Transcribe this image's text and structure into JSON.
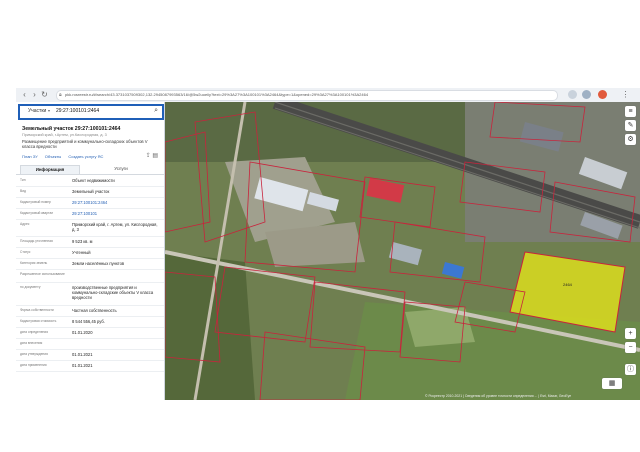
{
  "browser": {
    "url": "pkk.rosreestr.ru/#/search/43.3731037509302,132.2945087993563/16/@5w2uoeiiy?text=29%3A27%3A100101%3A2464&type=1&opened=29%3A27%3A100101%3A2464"
  },
  "search": {
    "type_label": "Участки",
    "query": "29:27:100101:2464"
  },
  "parcel": {
    "title": "Земельный участок 29:27:100101:2464",
    "address_line": "Приморский край, г.Артем, ул.Кислородная, д. 3",
    "description": "Размещение предприятий и коммунально-складских объектов V класса вредности",
    "links": [
      "План ЗУ",
      "Объекты",
      "Создать услугу ЯС"
    ]
  },
  "tabs": {
    "info": "Информация",
    "services": "Услуги"
  },
  "rows": [
    {
      "k": "Тип",
      "v": "Объект недвижимости",
      "link": false
    },
    {
      "k": "Вид",
      "v": "Земельный участок",
      "link": false
    },
    {
      "k": "Кадастровый номер",
      "v": "29:27:100101:2464",
      "link": true
    },
    {
      "k": "Кадастровый квартал",
      "v": "29:27:100101",
      "link": true
    },
    {
      "k": "Адрес",
      "v": "Приморский край, г. Артем, ул. Кислородная, д. 3",
      "link": false
    },
    {
      "k": "Площадь уточненная",
      "v": "9 523 кв. м",
      "link": false
    },
    {
      "k": "Статус",
      "v": "Учтенный",
      "link": false
    },
    {
      "k": "Категория земель",
      "v": "Земли населённых пунктов",
      "link": false
    },
    {
      "k": "Разрешенное использование",
      "v": "",
      "link": false
    },
    {
      "k": "по документу",
      "v": "производственные предприятия и коммунально-складские объекты V класса вредности",
      "link": false
    },
    {
      "k": "Форма собственности",
      "v": "Частная собственность",
      "link": false
    },
    {
      "k": "Кадастровая стоимость",
      "v": "8 544 556,45 руб.",
      "link": false
    },
    {
      "k": "дата определения",
      "v": "01.01.2020",
      "link": false
    },
    {
      "k": "дата внесения",
      "v": "",
      "link": false
    },
    {
      "k": "дата утверждения",
      "v": "01.01.2021",
      "link": false
    },
    {
      "k": "дата применения",
      "v": "01.01.2021",
      "link": false
    }
  ],
  "map": {
    "parcel_label": "2464",
    "footer": "© Росреестр 2010-2021 | Сведения об уровне точности определения ... | Esri, Maxar, GeoEye"
  },
  "colors": {
    "accent": "#1f5fb8",
    "highlight": "#e6e61a",
    "boundary": "#c8243c",
    "roof_red": "#d23a47",
    "roof_blue": "#3c78d2"
  }
}
